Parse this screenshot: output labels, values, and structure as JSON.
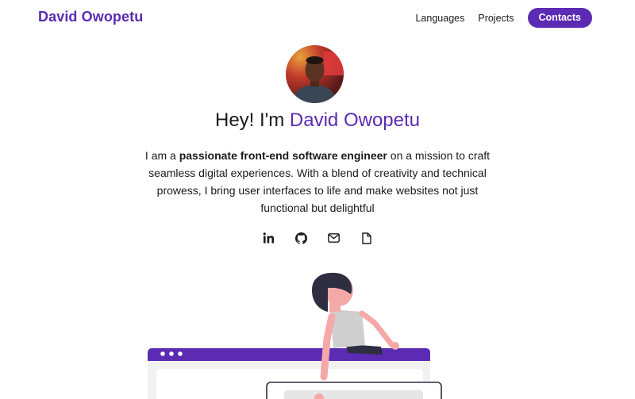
{
  "header": {
    "brand": "David Owopetu",
    "nav": {
      "languages": "Languages",
      "projects": "Projects",
      "contacts": "Contacts"
    }
  },
  "hero": {
    "greeting": "Hey! I'm ",
    "name": "David Owopetu",
    "bio_prefix": "I am a ",
    "bio_emphasis": "passionate front-end software engineer",
    "bio_suffix": " on a mission to craft seamless digital experiences. With a blend of creativity and technical prowess, I bring user interfaces to life and make websites not just functional but delightful"
  },
  "socials": [
    "linkedin-icon",
    "github-icon",
    "mail-icon",
    "document-icon"
  ],
  "colors": {
    "accent": "#5b2bb3",
    "text": "#1a1a1a",
    "illustration_skin": "#f4a9a8",
    "illustration_shirt": "#cfcfcf"
  }
}
